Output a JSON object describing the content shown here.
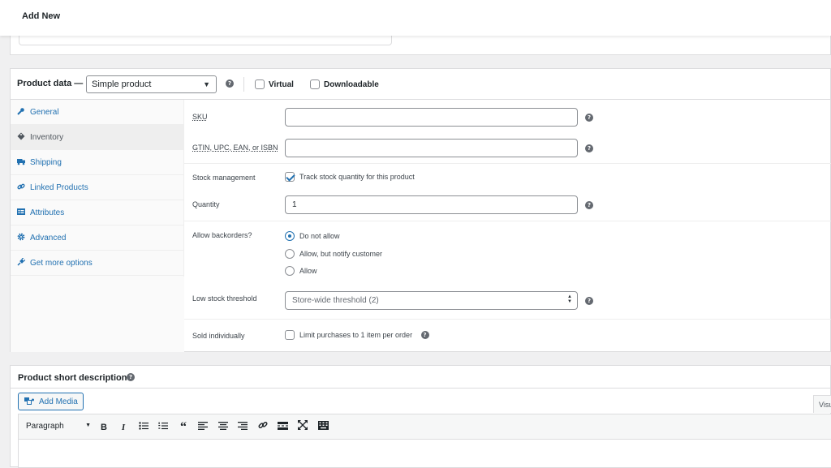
{
  "topbar": {
    "title": "Add New"
  },
  "product_data": {
    "label": "Product data —",
    "type_select": "Simple product",
    "virtual_label": "Virtual",
    "virtual_checked": false,
    "downloadable_label": "Downloadable",
    "downloadable_checked": false,
    "tabs": [
      {
        "label": "General",
        "icon": "wrench-icon",
        "active": false
      },
      {
        "label": "Inventory",
        "icon": "tag-icon",
        "active": true
      },
      {
        "label": "Shipping",
        "icon": "truck-icon",
        "active": false
      },
      {
        "label": "Linked Products",
        "icon": "link-icon",
        "active": false
      },
      {
        "label": "Attributes",
        "icon": "list-icon",
        "active": false
      },
      {
        "label": "Advanced",
        "icon": "gear-icon",
        "active": false
      },
      {
        "label": "Get more options",
        "icon": "plugin-icon",
        "active": false
      }
    ],
    "inventory": {
      "sku_label": "SKU",
      "sku_value": "",
      "gtin_label": "GTIN, UPC, EAN, or ISBN",
      "gtin_value": "",
      "stock_mgmt_label": "Stock management",
      "stock_mgmt_text": "Track stock quantity for this product",
      "stock_mgmt_checked": true,
      "quantity_label": "Quantity",
      "quantity_value": "1",
      "backorders_label": "Allow backorders?",
      "backorder_options": [
        {
          "label": "Do not allow",
          "selected": true
        },
        {
          "label": "Allow, but notify customer",
          "selected": false
        },
        {
          "label": "Allow",
          "selected": false
        }
      ],
      "low_stock_label": "Low stock threshold",
      "low_stock_placeholder": "Store-wide threshold (2)",
      "sold_ind_label": "Sold individually",
      "sold_ind_text": "Limit purchases to 1 item per order",
      "sold_ind_checked": false
    }
  },
  "short_description": {
    "title": "Product short description",
    "add_media": "Add Media",
    "visual_tab": "Visual",
    "format_select": "Paragraph"
  },
  "colors": {
    "accent": "#2271b1",
    "text": "#1d2327",
    "border": "#dcdcde"
  }
}
